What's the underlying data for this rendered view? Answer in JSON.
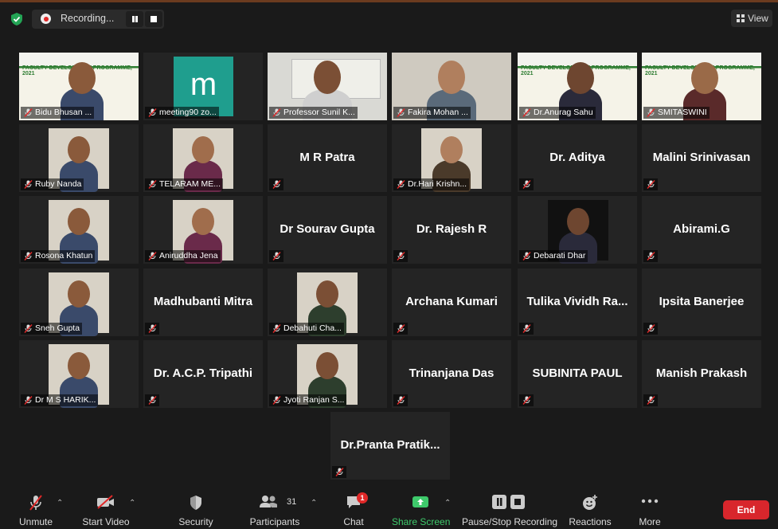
{
  "topbar": {
    "recording_label": "Recording...",
    "view_label": "View"
  },
  "participants": [
    {
      "name": "Bidu Bhusan ...",
      "kind": "slide"
    },
    {
      "name": "meeting90 zo...",
      "kind": "logo",
      "logo_letter": "m"
    },
    {
      "name": "Professor Sunil K...",
      "kind": "video",
      "active": true
    },
    {
      "name": "Fakira Mohan ...",
      "kind": "video"
    },
    {
      "name": "Dr.Anurag Sahu",
      "kind": "slide"
    },
    {
      "name": "SMITASWINI",
      "kind": "slide"
    },
    {
      "name": "Ruby Nanda",
      "kind": "photo"
    },
    {
      "name": "TELARAM ME...",
      "kind": "photo"
    },
    {
      "name": "M R Patra",
      "kind": "name"
    },
    {
      "name": "Dr.Hari Krishn...",
      "kind": "photo"
    },
    {
      "name": "Dr. Aditya",
      "kind": "name"
    },
    {
      "name": "Malini Srinivasan",
      "kind": "name"
    },
    {
      "name": "Rosona Khatun",
      "kind": "photo"
    },
    {
      "name": "Aniruddha Jena",
      "kind": "photo"
    },
    {
      "name": "Dr Sourav Gupta",
      "kind": "name"
    },
    {
      "name": "Dr. Rajesh R",
      "kind": "name"
    },
    {
      "name": "Debarati Dhar",
      "kind": "photo"
    },
    {
      "name": "Abirami.G",
      "kind": "name"
    },
    {
      "name": "Sneh Gupta",
      "kind": "photo"
    },
    {
      "name": "Madhubanti Mitra",
      "kind": "name"
    },
    {
      "name": "Debahuti Cha...",
      "kind": "photo"
    },
    {
      "name": "Archana Kumari",
      "kind": "name"
    },
    {
      "name": "Tulika Vividh Ra...",
      "kind": "name"
    },
    {
      "name": "Ipsita Banerjee",
      "kind": "name"
    },
    {
      "name": "Dr M S HARIK...",
      "kind": "photo"
    },
    {
      "name": "Dr. A.C.P. Tripathi",
      "kind": "name"
    },
    {
      "name": "Jyoti Ranjan S...",
      "kind": "photo"
    },
    {
      "name": "Trinanjana Das",
      "kind": "name"
    },
    {
      "name": "SUBINITA PAUL",
      "kind": "name"
    },
    {
      "name": "Manish Prakash",
      "kind": "name"
    },
    {
      "name": "Dr.Pranta  Pratik...",
      "kind": "name"
    }
  ],
  "slide_text": "FACULTY DEVELOPMENT PROGRAMME, 2021",
  "toolbar": {
    "unmute": "Unmute",
    "start_video": "Start Video",
    "security": "Security",
    "participants": "Participants",
    "participants_count": "31",
    "chat": "Chat",
    "chat_badge": "1",
    "share_screen": "Share Screen",
    "pause_stop_recording": "Pause/Stop Recording",
    "reactions": "Reactions",
    "more": "More",
    "end": "End"
  },
  "colors": {
    "active_speaker_border": "#b7e36a",
    "share_green": "#3ec96b",
    "end_red": "#d8262c",
    "tile_bg": "#242424"
  }
}
